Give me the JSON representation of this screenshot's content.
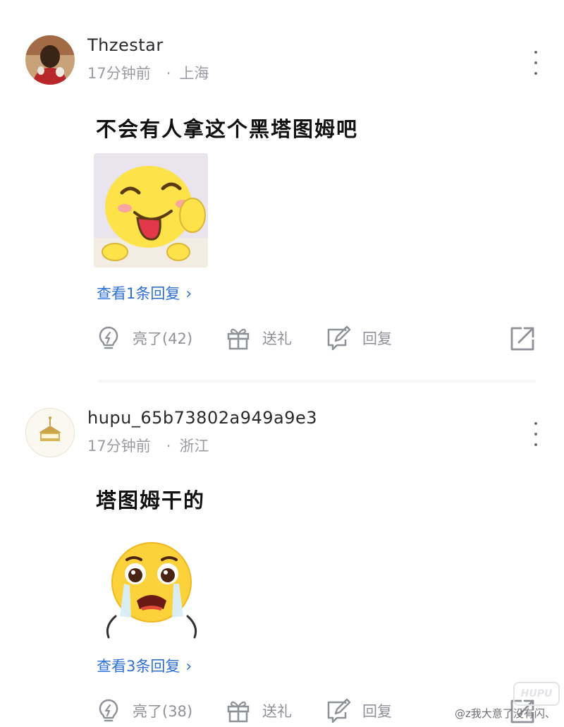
{
  "posts": [
    {
      "username": "Thzestar",
      "time": "17分钟前",
      "location": "上海",
      "text": "不会有人拿这个黑塔图姆吧",
      "sticker": "laughing-tongue-thumbs-up-sticker",
      "reply_link": "查看1条回复",
      "actions": {
        "light": "亮了(42)",
        "gift": "送礼",
        "reply": "回复"
      }
    },
    {
      "username": "hupu_65b73802a949a9e3",
      "time": "17分钟前",
      "location": "浙江",
      "text": "塔图姆干的",
      "sticker": "crying-face-sticker",
      "reply_link": "查看3条回复",
      "actions": {
        "light": "亮了(38)",
        "gift": "送礼",
        "reply": "回复"
      }
    }
  ],
  "separator": "·",
  "chevron": "›",
  "watermark": "@z我大意了没有闪、",
  "watermark_logo": "HUPU",
  "colors": {
    "link": "#2d6fd6",
    "meta": "#9a9ca3",
    "icon": "#8f9198"
  }
}
